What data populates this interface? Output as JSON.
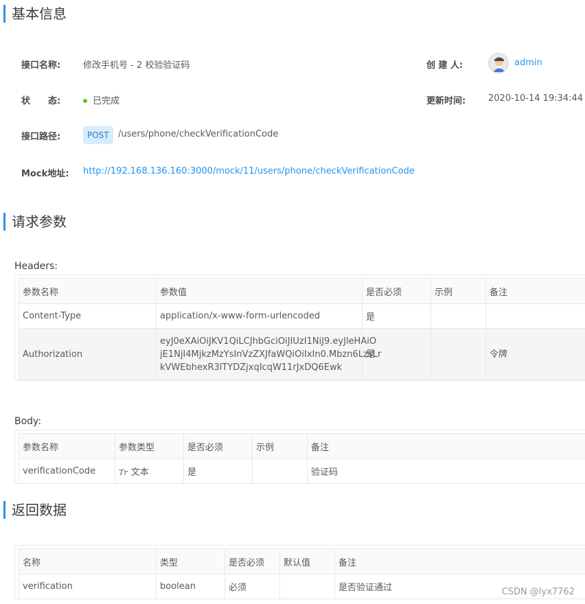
{
  "sections": {
    "basic_info": "基本信息",
    "request_params": "请求参数",
    "response_data": "返回数据"
  },
  "basic_info": {
    "name_label": "接口名称:",
    "name_value": "修改手机号 - 2 校验验证码",
    "creator_label": "创 建 人:",
    "creator_value": "admin",
    "status_label": "状　　态:",
    "status_value": "已完成",
    "updated_label": "更新时间:",
    "updated_value": "2020-10-14 19:34:44",
    "path_label": "接口路径:",
    "method": "POST",
    "path_value": "/users/phone/checkVerificationCode",
    "mock_label": "Mock地址:",
    "mock_value": "http://192.168.136.160:3000/mock/11/users/phone/checkVerificationCode",
    "status_color": "#52c41a",
    "link_color": "#2395f1"
  },
  "headers": {
    "title": "Headers:",
    "columns": [
      "参数名称",
      "参数值",
      "是否必须",
      "示例",
      "备注"
    ],
    "rows": [
      [
        "Content-Type",
        "application/x-www-form-urlencoded",
        "是",
        "",
        ""
      ],
      [
        "Authorization",
        "eyJ0eXAiOiJKV1QiLCJhbGciOiJIUzI1NiJ9.eyJleHAiOjE1NjI4MjkzMzYsInVzZXJfaWQiOiIxIn0.Mbzn6LzsLrkVWEbhexR3lTYDZjxqIcqW11rJxDQ6Ewk",
        "是",
        "",
        "令牌"
      ]
    ],
    "auth_value_lines": [
      "eyJ0eXAiOiJKV1QiLCJhbGciOiJIUzI1NiJ9.eyJleHAiO",
      "jE1NjI4MjkzMzYsInVzZXJfaWQiOiIxIn0.Mbzn6LzsLr",
      "kVWEbhexR3lTYDZjxqIcqW11rJxDQ6Ewk"
    ]
  },
  "body": {
    "title": "Body:",
    "columns": [
      "参数名称",
      "参数类型",
      "是否必须",
      "示例",
      "备注"
    ],
    "rows": [
      [
        "verificationCode",
        "文本",
        "是",
        "",
        "验证码"
      ]
    ],
    "type_icon": "Tr"
  },
  "response": {
    "columns": [
      "名称",
      "类型",
      "是否必须",
      "默认值",
      "备注"
    ],
    "rows": [
      [
        "verification",
        "boolean",
        "必须",
        "",
        "是否验证通过"
      ]
    ]
  },
  "watermark": "CSDN @lyx7762"
}
